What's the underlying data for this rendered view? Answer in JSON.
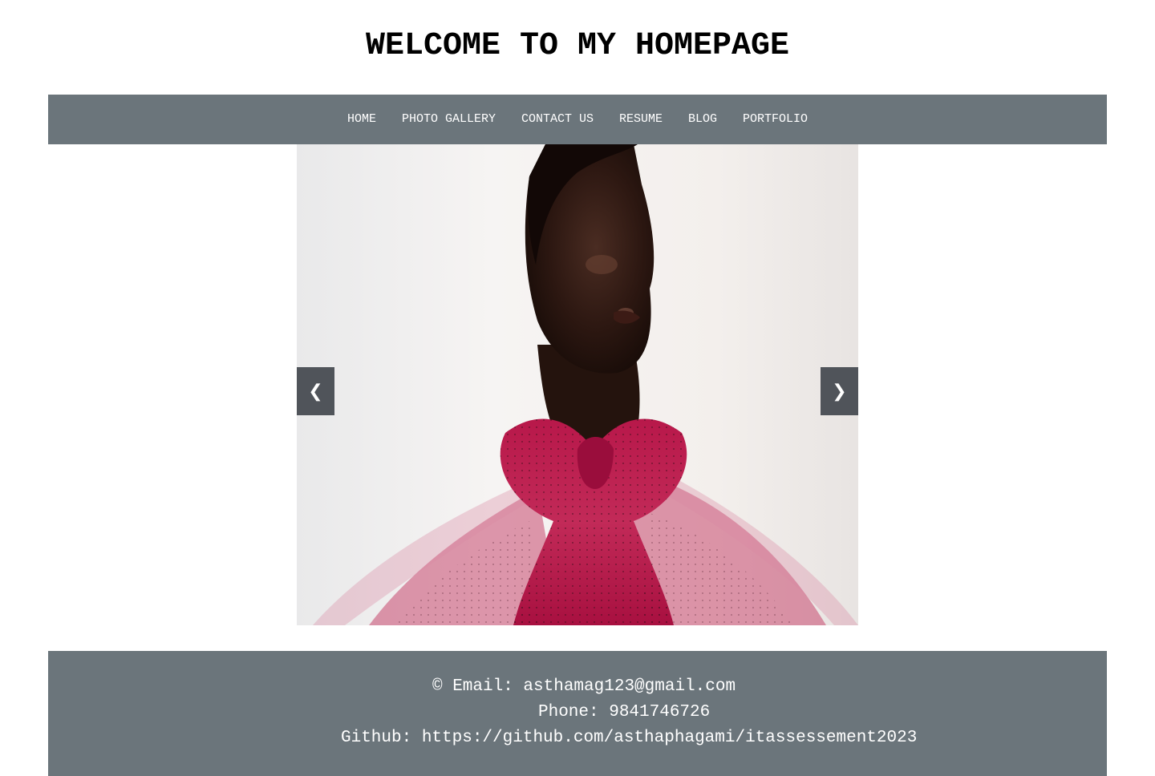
{
  "header": {
    "title": "WELCOME TO MY HOMEPAGE"
  },
  "nav": {
    "items": [
      {
        "label": "HOME"
      },
      {
        "label": "PHOTO GALLERY"
      },
      {
        "label": "CONTACT US"
      },
      {
        "label": "RESUME"
      },
      {
        "label": "BLOG"
      },
      {
        "label": "PORTFOLIO"
      }
    ]
  },
  "slideshow": {
    "prev_label": "❮",
    "next_label": "❯",
    "image_subject": "fashion-portrait-photo"
  },
  "footer": {
    "email_line": "© Email: asthamag123@gmail.com",
    "phone_line": "Phone: 9841746726",
    "github_line": "Github: https://github.com/asthaphagami/itassessement2023"
  },
  "colors": {
    "nav_background": "#6b757b",
    "footer_background": "#6b757b",
    "slide_button_background": "#484c52",
    "text_light": "#ffffff",
    "title_text": "#000000"
  }
}
